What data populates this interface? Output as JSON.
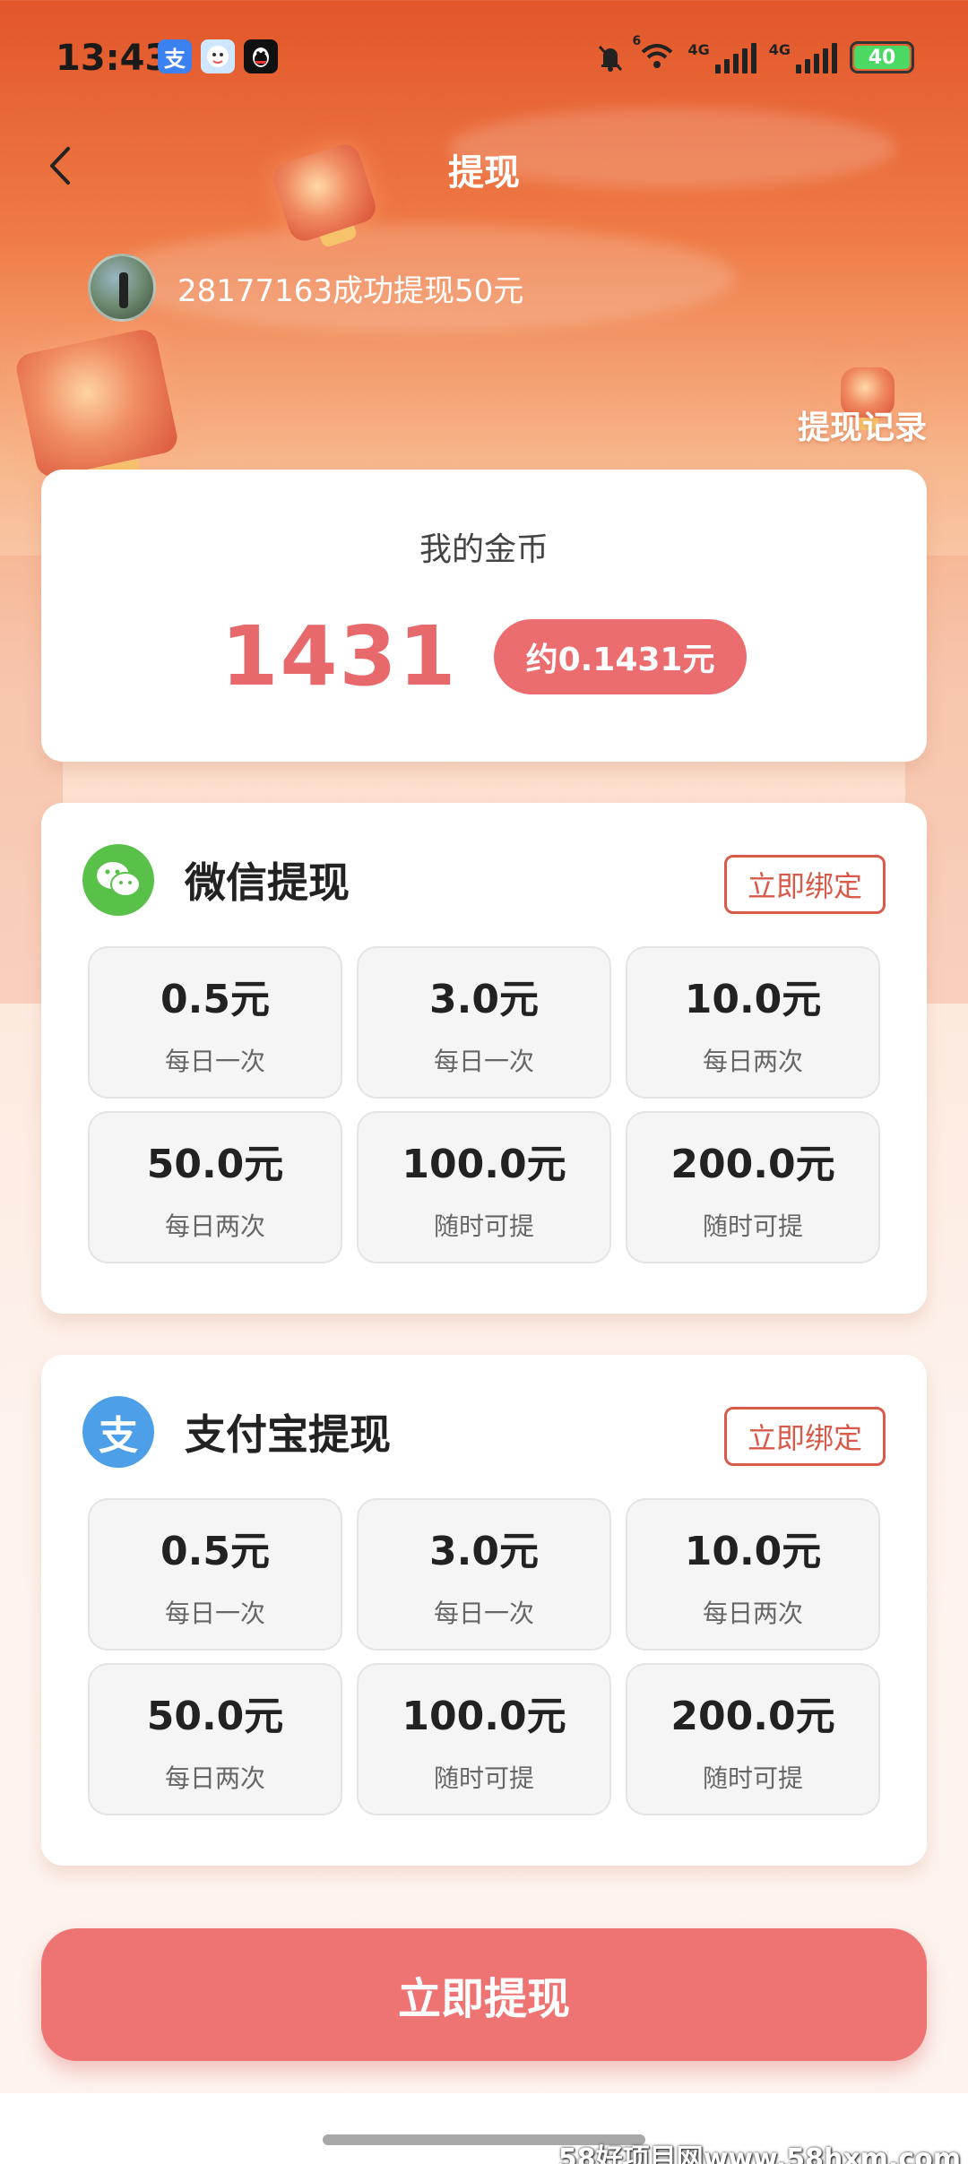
{
  "status_bar": {
    "time": "13:43",
    "apps": [
      "alipay",
      "qq-browser",
      "qq"
    ],
    "alipay_glyph": "支",
    "network_1": "4G",
    "network_2": "4G",
    "wifi_badge": "6",
    "battery": "40"
  },
  "header": {
    "title": "提现",
    "back_icon": "chevron-left-icon"
  },
  "ticker": {
    "text": "28177163成功提现50元"
  },
  "records_link": "提现记录",
  "coins": {
    "label": "我的金币",
    "value": "1431",
    "approx": "约0.1431元"
  },
  "wechat": {
    "title": "微信提现",
    "bind_label": "立即绑定",
    "icon": "wechat-icon",
    "color": "#59c14a",
    "options": [
      {
        "amount": "0.5元",
        "note": "每日一次"
      },
      {
        "amount": "3.0元",
        "note": "每日一次"
      },
      {
        "amount": "10.0元",
        "note": "每日两次"
      },
      {
        "amount": "50.0元",
        "note": "每日两次"
      },
      {
        "amount": "100.0元",
        "note": "随时可提"
      },
      {
        "amount": "200.0元",
        "note": "随时可提"
      }
    ]
  },
  "alipay": {
    "title": "支付宝提现",
    "bind_label": "立即绑定",
    "icon": "alipay-icon",
    "glyph": "支",
    "color": "#4d9fe8",
    "options": [
      {
        "amount": "0.5元",
        "note": "每日一次"
      },
      {
        "amount": "3.0元",
        "note": "每日一次"
      },
      {
        "amount": "10.0元",
        "note": "每日两次"
      },
      {
        "amount": "50.0元",
        "note": "每日两次"
      },
      {
        "amount": "100.0元",
        "note": "随时可提"
      },
      {
        "amount": "200.0元",
        "note": "随时可提"
      }
    ]
  },
  "submit_label": "立即提现",
  "watermark": "58好项目网www.58hxm.com",
  "colors": {
    "accent": "#ec6d6f",
    "bind_border": "#d85a4a"
  }
}
